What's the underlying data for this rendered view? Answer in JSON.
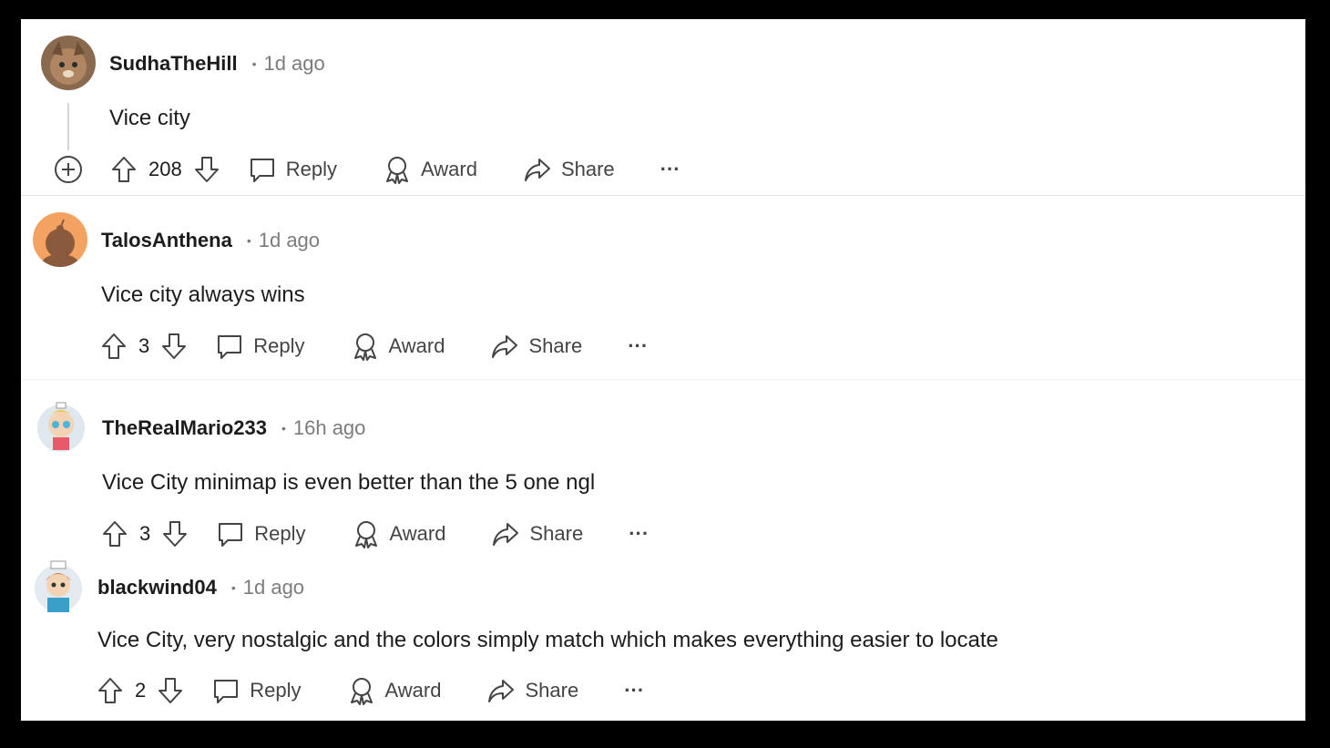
{
  "comments": [
    {
      "username": "SudhaTheHill",
      "time": "1d ago",
      "text": "Vice city",
      "votes": "208",
      "reply": "Reply",
      "award": "Award",
      "share": "Share",
      "more": "···"
    },
    {
      "username": "TalosAnthena",
      "time": "1d ago",
      "text": "Vice city always wins",
      "votes": "3",
      "reply": "Reply",
      "award": "Award",
      "share": "Share",
      "more": "···"
    },
    {
      "username": "TheRealMario233",
      "time": "16h ago",
      "text": "Vice City minimap is even better than the 5 one ngl",
      "votes": "3",
      "reply": "Reply",
      "award": "Award",
      "share": "Share",
      "more": "···"
    },
    {
      "username": "blackwind04",
      "time": "1d ago",
      "text": "Vice City, very nostalgic and the colors simply match which makes everything easier to locate",
      "votes": "2",
      "reply": "Reply",
      "award": "Award",
      "share": "Share",
      "more": "···"
    }
  ],
  "separator": "•",
  "colors": {
    "text": "#1c1c1c",
    "muted": "#7c7c7c",
    "icon": "#444444",
    "divider": "#dfe1e3",
    "background": "#ffffff",
    "frame": "#000000"
  }
}
